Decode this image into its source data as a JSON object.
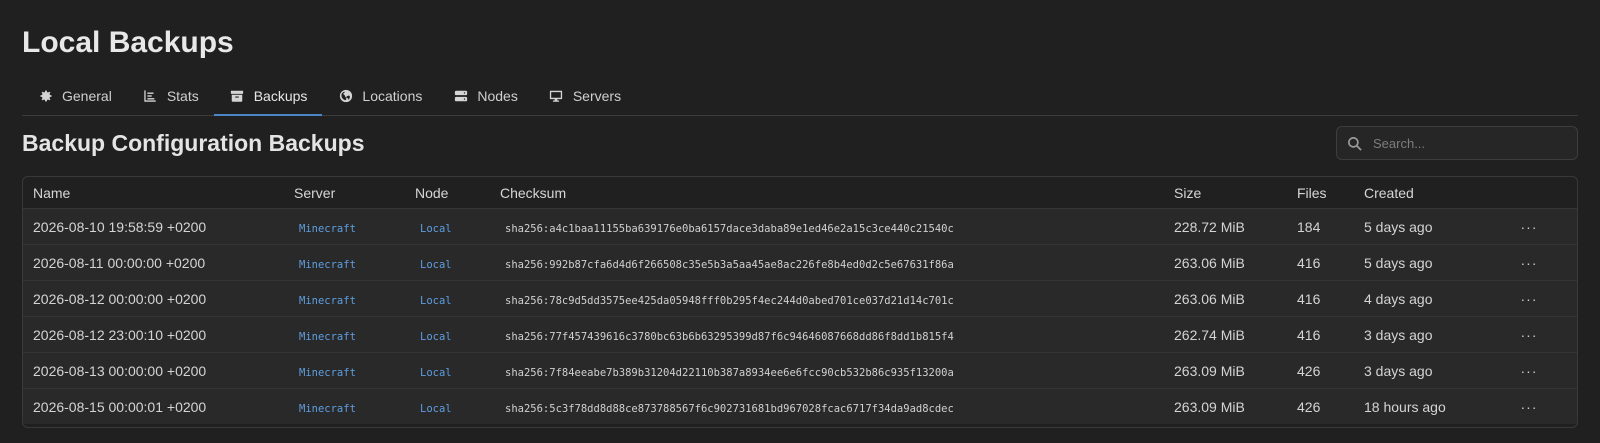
{
  "page": {
    "title": "Local Backups"
  },
  "tabs": [
    {
      "label": "General",
      "icon": "gear-icon"
    },
    {
      "label": "Stats",
      "icon": "chart-icon"
    },
    {
      "label": "Backups",
      "icon": "archive-icon",
      "active": true
    },
    {
      "label": "Locations",
      "icon": "globe-icon"
    },
    {
      "label": "Nodes",
      "icon": "server-icon"
    },
    {
      "label": "Servers",
      "icon": "monitor-icon"
    }
  ],
  "section": {
    "title": "Backup Configuration Backups"
  },
  "search": {
    "placeholder": "Search..."
  },
  "table": {
    "columns": [
      "Name",
      "Server",
      "Node",
      "Checksum",
      "Size",
      "Files",
      "Created"
    ],
    "rows": [
      {
        "name": "2026-08-10 19:58:59 +0200",
        "server": "Minecraft",
        "node": "Local",
        "checksum": "sha256:a4c1baa11155ba639176e0ba6157dace3daba89e1ed46e2a15c3ce440c21540c",
        "size": "228.72 MiB",
        "files": "184",
        "created": "5 days ago"
      },
      {
        "name": "2026-08-11 00:00:00 +0200",
        "server": "Minecraft",
        "node": "Local",
        "checksum": "sha256:992b87cfa6d4d6f266508c35e5b3a5aa45ae8ac226fe8b4ed0d2c5e67631f86a",
        "size": "263.06 MiB",
        "files": "416",
        "created": "5 days ago"
      },
      {
        "name": "2026-08-12 00:00:00 +0200",
        "server": "Minecraft",
        "node": "Local",
        "checksum": "sha256:78c9d5dd3575ee425da05948fff0b295f4ec244d0abed701ce037d21d14c701c",
        "size": "263.06 MiB",
        "files": "416",
        "created": "4 days ago"
      },
      {
        "name": "2026-08-12 23:00:10 +0200",
        "server": "Minecraft",
        "node": "Local",
        "checksum": "sha256:77f457439616c3780bc63b6b63295399d87f6c94646087668dd86f8dd1b815f4",
        "size": "262.74 MiB",
        "files": "416",
        "created": "3 days ago"
      },
      {
        "name": "2026-08-13 00:00:00 +0200",
        "server": "Minecraft",
        "node": "Local",
        "checksum": "sha256:7f84eeabe7b389b31204d22110b387a8934ee6e6fcc90cb532b86c935f13200a",
        "size": "263.09 MiB",
        "files": "426",
        "created": "3 days ago"
      },
      {
        "name": "2026-08-15 00:00:01 +0200",
        "server": "Minecraft",
        "node": "Local",
        "checksum": "sha256:5c3f78dd8d88ce873788567f6c902731681bd967028fcac6717f34da9ad8cdec",
        "size": "263.09 MiB",
        "files": "426",
        "created": "18 hours ago"
      }
    ],
    "row_menu_label": "···"
  },
  "colors": {
    "background": "#202020",
    "accent": "#4b86c6",
    "tag": "#5e9ee0"
  }
}
